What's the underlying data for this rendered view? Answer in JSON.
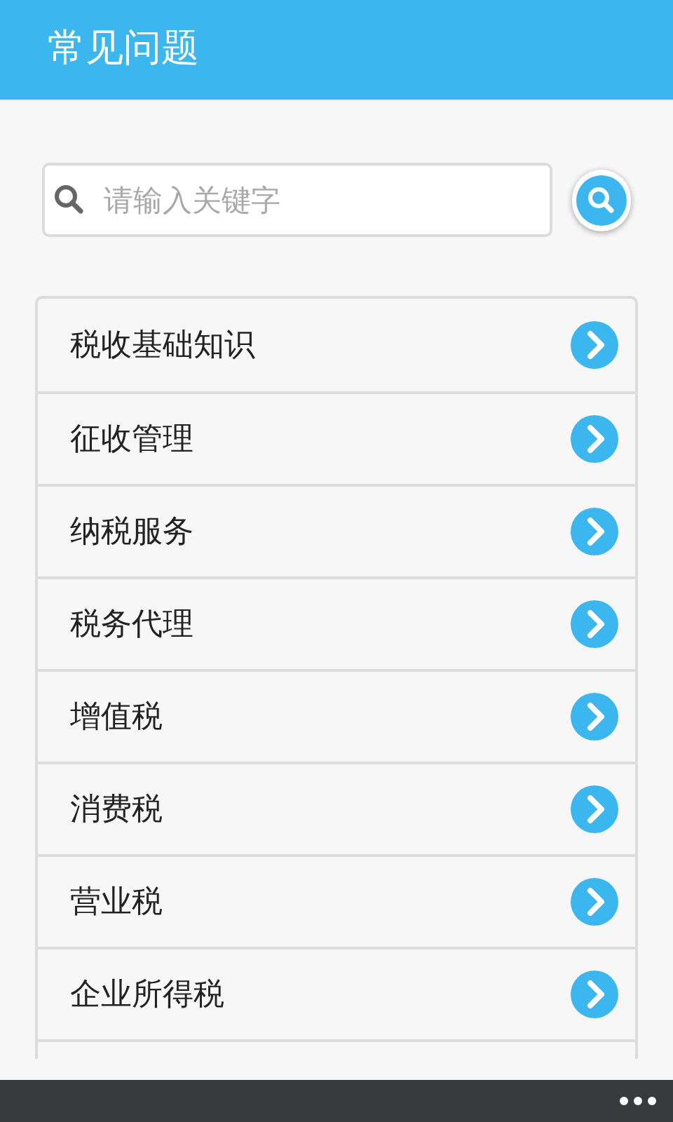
{
  "header": {
    "title": "常见问题"
  },
  "search": {
    "placeholder": "请输入关键字"
  },
  "categories": [
    {
      "label": "税收基础知识"
    },
    {
      "label": "征收管理"
    },
    {
      "label": "纳税服务"
    },
    {
      "label": "税务代理"
    },
    {
      "label": "增值税"
    },
    {
      "label": "消费税"
    },
    {
      "label": "营业税"
    },
    {
      "label": "企业所得税"
    }
  ]
}
